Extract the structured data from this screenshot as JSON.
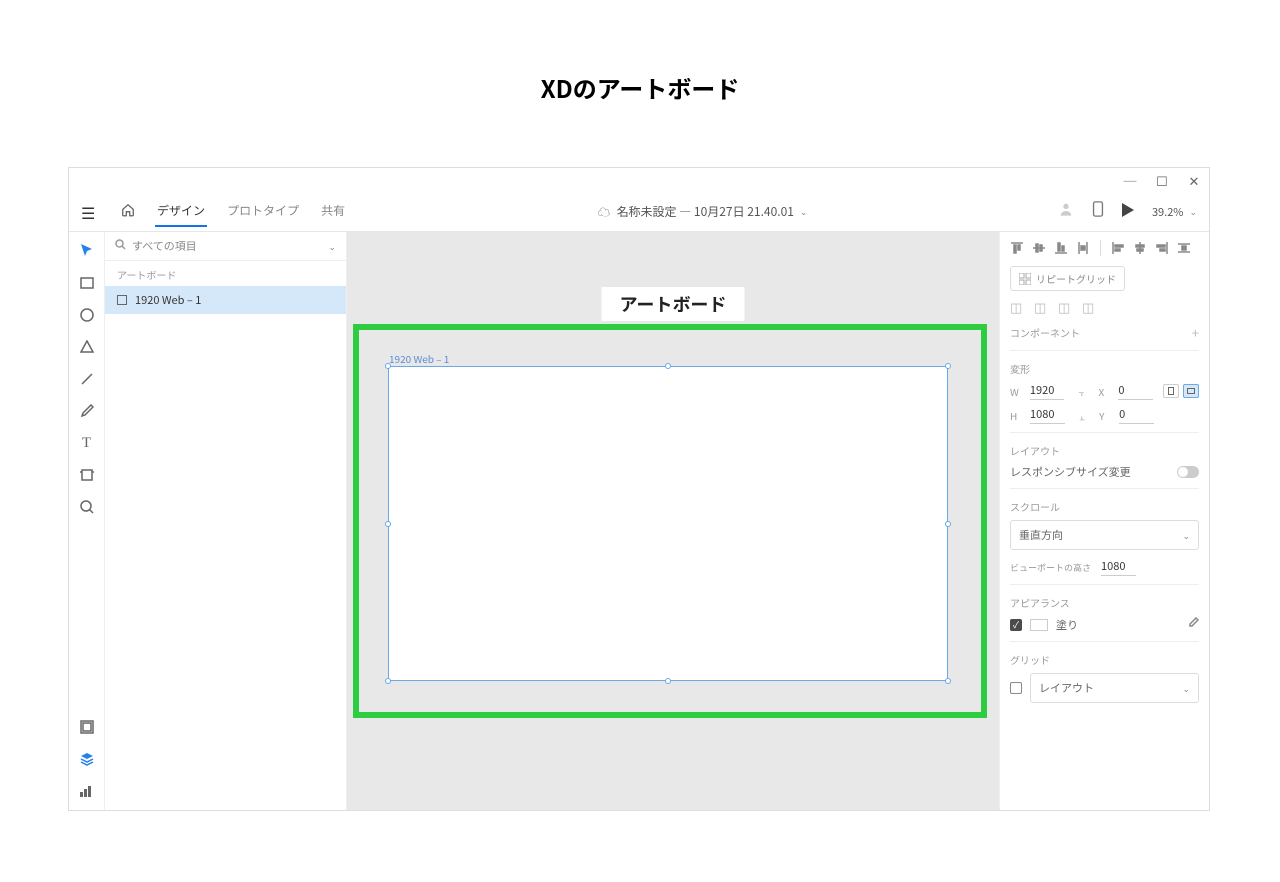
{
  "page_title": "XDのアートボード",
  "window": {
    "doc_title": "名称未設定 ― 10月27日 21.40.01",
    "zoom": "39.2%"
  },
  "tabs": {
    "design": "デザイン",
    "prototype": "プロトタイプ",
    "share": "共有"
  },
  "layers": {
    "search_placeholder": "すべての項目",
    "section_label": "アートボード",
    "items": [
      "1920 Web – 1"
    ]
  },
  "canvas": {
    "annotation": "アートボード",
    "artboard_name": "1920 Web – 1"
  },
  "properties": {
    "repeat_grid": "リピートグリッド",
    "component_label": "コンポーネント",
    "transform": {
      "label": "変形",
      "w": "1920",
      "h": "1080",
      "x": "0",
      "y": "0",
      "w_lbl": "W",
      "h_lbl": "H",
      "x_lbl": "X",
      "y_lbl": "Y"
    },
    "layout": {
      "label": "レイアウト",
      "responsive": "レスポンシブサイズ変更"
    },
    "scroll": {
      "label": "スクロール",
      "value": "垂直方向",
      "viewport_label": "ビューポートの高さ",
      "viewport_value": "1080"
    },
    "appearance": {
      "label": "アピアランス",
      "fill": "塗り"
    },
    "grid": {
      "label": "グリッド",
      "value": "レイアウト"
    }
  }
}
